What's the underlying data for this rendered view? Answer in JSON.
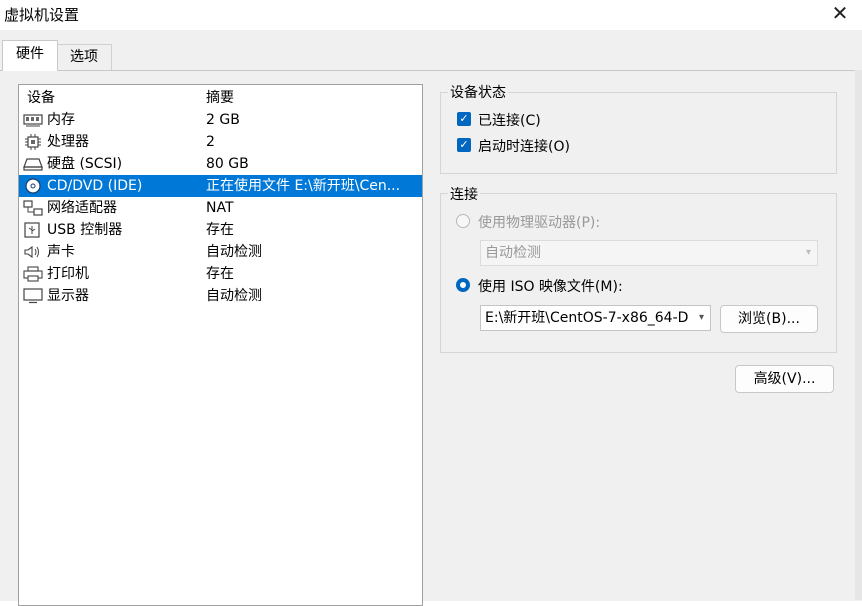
{
  "window": {
    "title": "虚拟机设置",
    "close_glyph": "✕"
  },
  "tabs": [
    {
      "label": "硬件"
    },
    {
      "label": "选项"
    }
  ],
  "device_list": {
    "headers": {
      "device": "设备",
      "summary": "摘要"
    },
    "rows": [
      {
        "icon": "memory-icon",
        "name": "内存",
        "summary": "2 GB"
      },
      {
        "icon": "processor-icon",
        "name": "处理器",
        "summary": "2"
      },
      {
        "icon": "hard-disk-icon",
        "name": "硬盘 (SCSI)",
        "summary": "80 GB"
      },
      {
        "icon": "cd-dvd-icon",
        "name": "CD/DVD (IDE)",
        "summary": "正在使用文件 E:\\新开班\\Cen...",
        "selected": true
      },
      {
        "icon": "network-adapter-icon",
        "name": "网络适配器",
        "summary": "NAT"
      },
      {
        "icon": "usb-icon",
        "name": "USB 控制器",
        "summary": "存在"
      },
      {
        "icon": "sound-icon",
        "name": "声卡",
        "summary": "自动检测"
      },
      {
        "icon": "printer-icon",
        "name": "打印机",
        "summary": "存在"
      },
      {
        "icon": "display-icon",
        "name": "显示器",
        "summary": "自动检测"
      }
    ]
  },
  "device_status": {
    "label": "设备状态",
    "connected": {
      "label": "已连接(C)",
      "checked": true
    },
    "connect_at_power_on": {
      "label": "启动时连接(O)",
      "checked": true
    }
  },
  "connection": {
    "label": "连接",
    "physical_drive": {
      "label": "使用物理驱动器(P):",
      "selected": false,
      "enabled": false,
      "value": "自动检测"
    },
    "iso_image": {
      "label": "使用 ISO 映像文件(M):",
      "selected": true,
      "value": "E:\\新开班\\CentOS-7-x86_64-D"
    },
    "browse_label": "浏览(B)..."
  },
  "advanced_label": "高级(V)...",
  "colors": {
    "selection": "#0078d7",
    "accent": "#0067c0",
    "dialog_bg": "#f0f0f0"
  }
}
